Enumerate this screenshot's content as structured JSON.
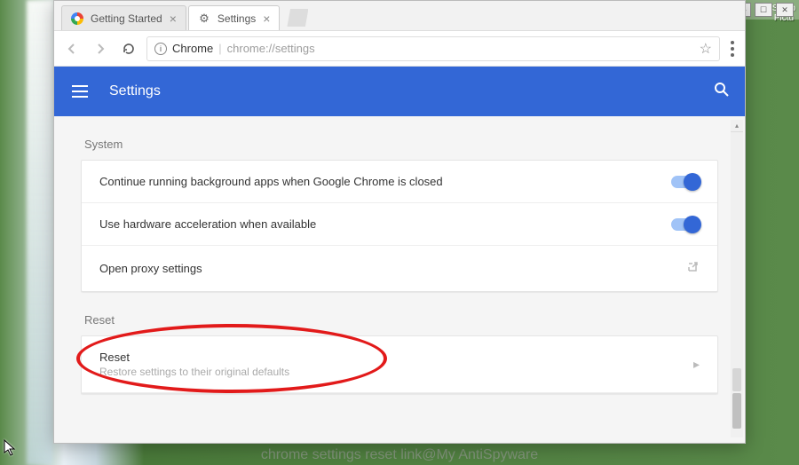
{
  "window_controls": {
    "user": "👤",
    "min": "—",
    "max": "☐",
    "close": "✕"
  },
  "desktop": {
    "icon_label": "Samp\nPictu"
  },
  "tabs": [
    {
      "label": "Getting Started",
      "active": false,
      "favicon": "chrome"
    },
    {
      "label": "Settings",
      "active": true,
      "favicon": "gear"
    }
  ],
  "address": {
    "origin": "Chrome",
    "path": "chrome://settings",
    "info_label": "ⓘ"
  },
  "header": {
    "title": "Settings"
  },
  "sections": {
    "system": {
      "label": "System",
      "rows": [
        {
          "text": "Continue running background apps when Google Chrome is closed",
          "control": "toggle",
          "value": true
        },
        {
          "text": "Use hardware acceleration when available",
          "control": "toggle",
          "value": true
        },
        {
          "text": "Open proxy settings",
          "control": "external"
        }
      ]
    },
    "reset": {
      "label": "Reset",
      "rows": [
        {
          "text": "Reset",
          "sub": "Restore settings to their original defaults",
          "control": "chevron"
        }
      ]
    }
  },
  "watermark": "chrome settings reset link@My AntiSpyware"
}
